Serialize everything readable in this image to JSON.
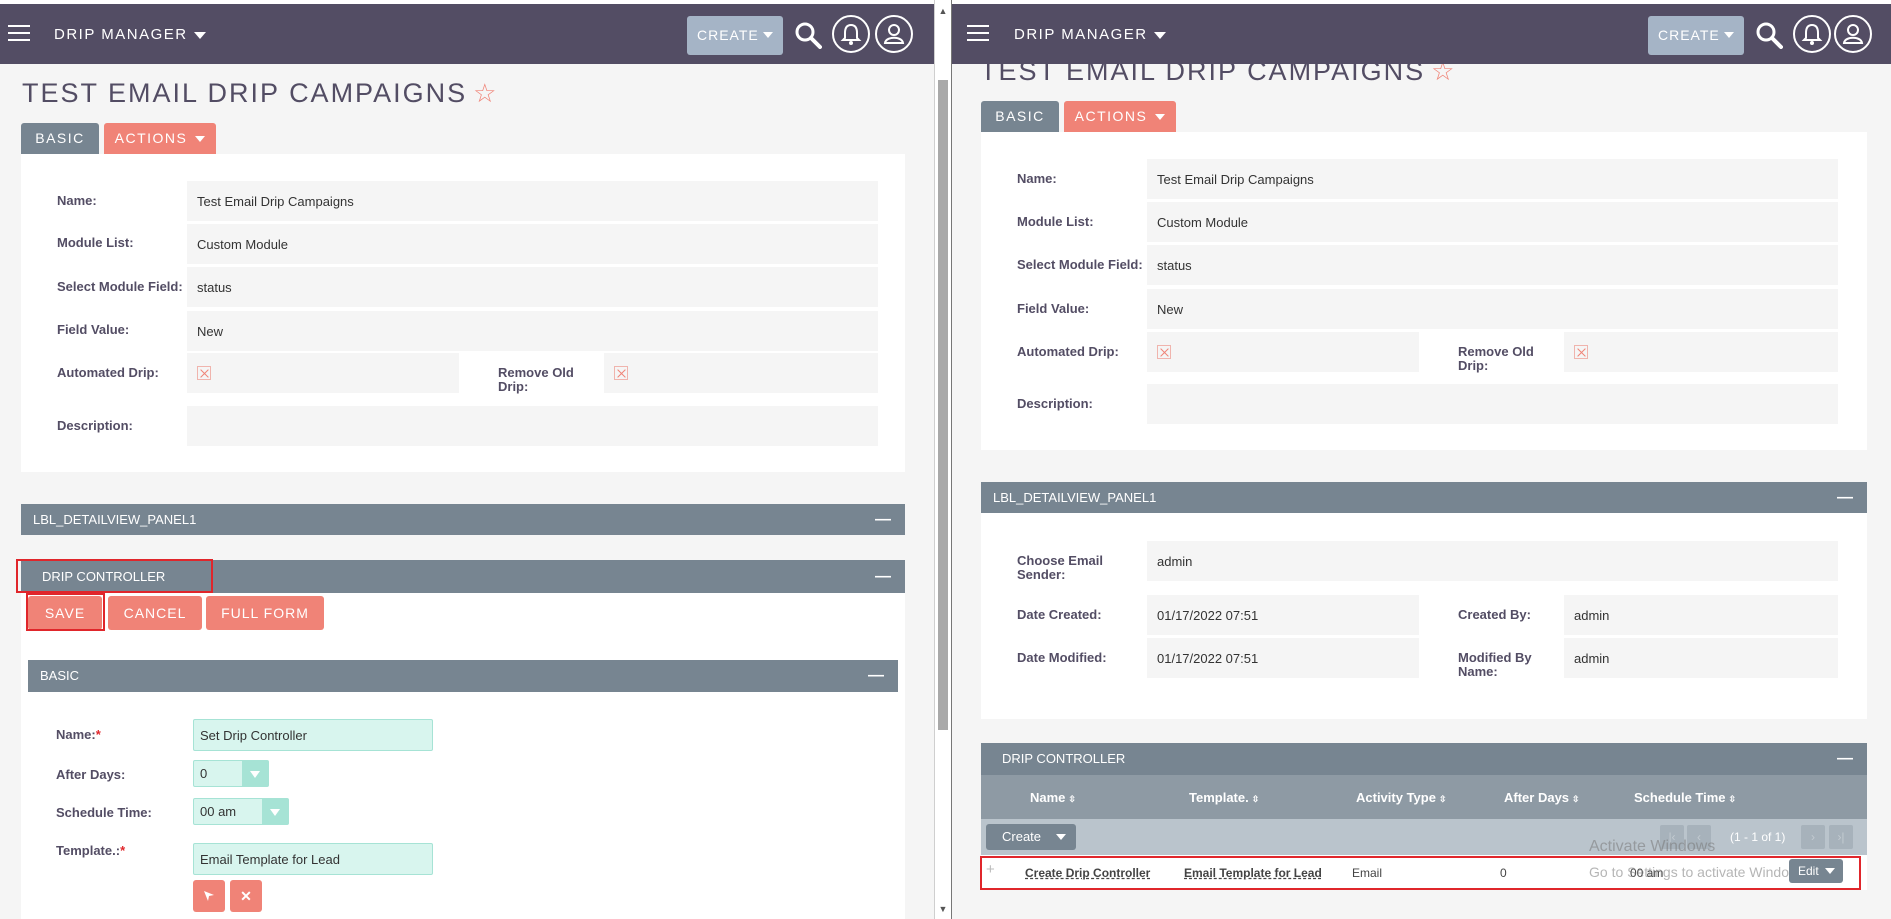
{
  "app": {
    "brand": "DRIP MANAGER",
    "create_label": "CREATE"
  },
  "record": {
    "title": "TEST EMAIL DRIP CAMPAIGNS",
    "tabs": {
      "basic": "BASIC",
      "actions": "ACTIONS"
    },
    "fields": {
      "name_label": "Name:",
      "name_value": "Test Email Drip Campaigns",
      "module_list_label": "Module List:",
      "module_list_value": "Custom Module",
      "select_module_field_label": "Select Module Field:",
      "select_module_field_value": "status",
      "field_value_label": "Field Value:",
      "field_value_value": "New",
      "automated_drip_label": "Automated Drip:",
      "remove_old_drip_label_1": "Remove Old",
      "remove_old_drip_label_2": "Drip:",
      "description_label": "Description:"
    },
    "panel1_title": "LBL_DETAILVIEW_PANEL1",
    "panel1_fields": {
      "email_sender_label_1": "Choose Email",
      "email_sender_label_2": "Sender:",
      "email_sender_value": "admin",
      "date_created_label": "Date Created:",
      "date_created_value": "01/17/2022 07:51",
      "created_by_label": "Created By:",
      "created_by_value": "admin",
      "date_modified_label": "Date Modified:",
      "date_modified_value": "01/17/2022 07:51",
      "modified_by_label_1": "Modified By",
      "modified_by_label_2": "Name:",
      "modified_by_value": "admin"
    }
  },
  "drip_form": {
    "header": "DRIP CONTROLLER",
    "save": "SAVE",
    "cancel": "CANCEL",
    "full_form": "FULL FORM",
    "basic_header": "BASIC",
    "name_label": "Name:",
    "name_value": "Set Drip Controller",
    "after_days_label": "After Days:",
    "after_days_value": "0",
    "schedule_time_label": "Schedule Time:",
    "schedule_time_value": "00 am",
    "template_label": "Template.:",
    "template_value": "Email Template for Lead",
    "required_mark": "*"
  },
  "subpanel": {
    "header": "DRIP CONTROLLER",
    "columns": [
      "Name",
      "Template.",
      "Activity Type",
      "After Days",
      "Schedule Time"
    ],
    "create_label": "Create",
    "pagination_text": "(1 - 1 of 1)",
    "rows": [
      {
        "name": "Create Drip Controller",
        "template": "Email Template for Lead",
        "activity_type": "Email",
        "after_days": "0",
        "schedule_time": "00 am",
        "action": "Edit"
      }
    ]
  },
  "watermark": {
    "line1": "Activate Windows",
    "line2": "Go to Settings to activate Windows."
  },
  "colors": {
    "topbar": "#534d64",
    "accent": "#f08377",
    "panel": "#778591",
    "highlight": "#e0262b"
  }
}
